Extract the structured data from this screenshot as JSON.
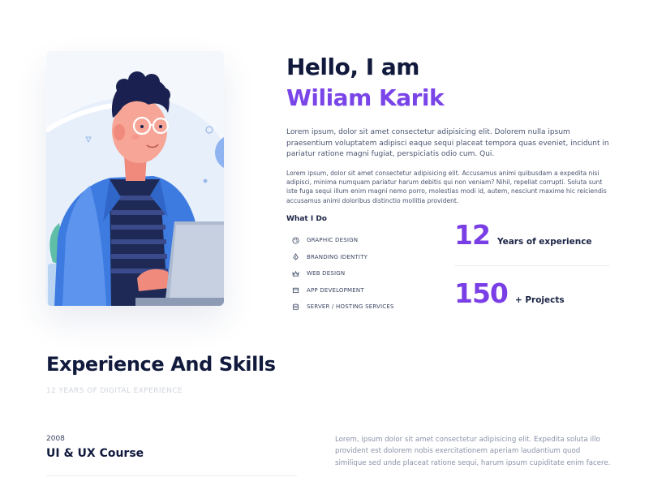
{
  "intro": {
    "greeting": "Hello, I am",
    "name": "Wiliam Karik",
    "paragraph1": "Lorem ipsum, dolor sit amet consectetur adipisicing elit. Dolorem nulla ipsum praesentium voluptatem adipisci eaque sequi placeat tempora quas eveniet, incidunt in pariatur ratione magni fugiat, perspiciatis odio cum. Qui.",
    "paragraph2": "Lorem ipsum, dolor sit amet consectetur adipisicing elit. Accusamus animi quibusdam a expedita nisi adipisci, minima numquam pariatur harum debitis qui non veniam? Nihil, repellat corrupti. Soluta sunt iste fuga sequi illum enim magni nemo porro, molestias modi id, autem, nesciunt maxime hic reiciendis accusamus animi doloribus distinctio mollitia provident."
  },
  "what_i_do": {
    "heading": "What I Do",
    "items": [
      {
        "label": "GRAPHIC DESIGN",
        "icon": "palette-icon"
      },
      {
        "label": "BRANDING IDENTITY",
        "icon": "pen-nib-icon"
      },
      {
        "label": "WEB DESIGN",
        "icon": "crown-icon"
      },
      {
        "label": "APP DEVELOPMENT",
        "icon": "box-icon"
      },
      {
        "label": "SERVER / HOSTING SERVICES",
        "icon": "database-icon"
      }
    ]
  },
  "stats": [
    {
      "number": "12",
      "label": "Years of experience"
    },
    {
      "number": "150",
      "label": "+ Projects"
    }
  ],
  "experience": {
    "title": "Experience And Skills",
    "subtitle": "12 YEARS OF DIGITAL EXPERIENCE",
    "entries": [
      {
        "year": "2008",
        "title": "UI & UX Course",
        "description": "Lorem, ipsum dolor sit amet consectetur adipisicing elit. Expedita soluta illo provident est dolorem nobis exercitationem aperiam laudantium quod similique sed unde placeat ratione sequi, harum ipsum cupiditate enim facere."
      }
    ]
  },
  "colors": {
    "accent": "#7a45e8",
    "heading": "#111a3c",
    "muted": "#8a92a8"
  }
}
